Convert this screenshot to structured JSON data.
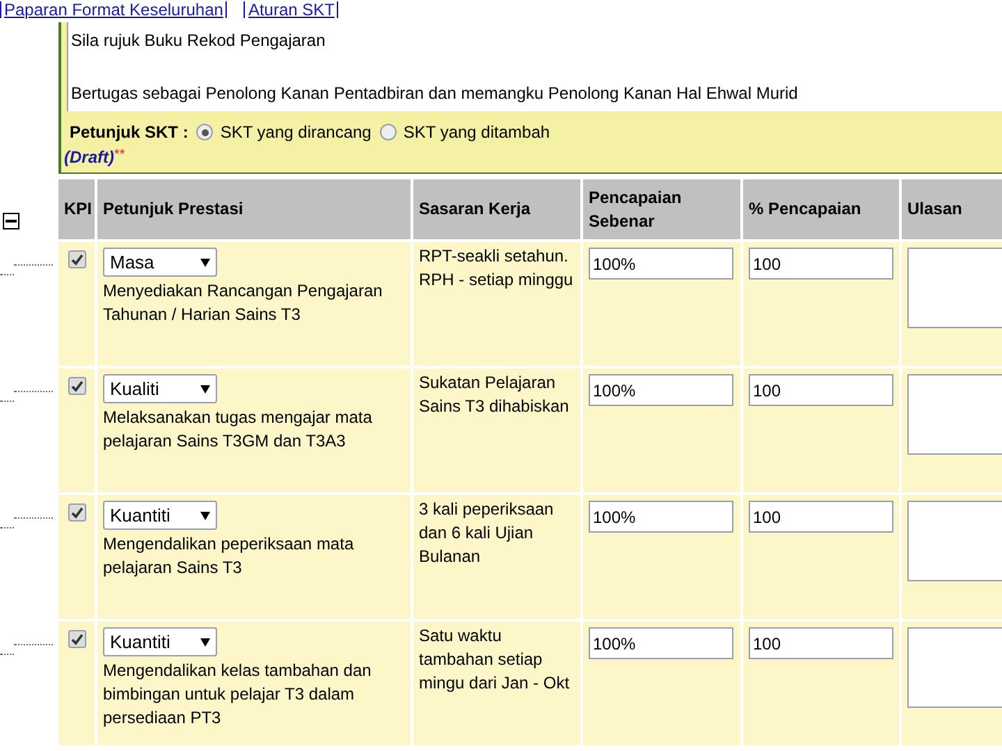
{
  "links": [
    "Paparan Format Keseluruhan",
    "Aturan SKT"
  ],
  "notes": [
    "Sila rujuk Buku Rekod Pengajaran",
    "Bertugas sebagai Penolong Kanan Pentadbiran dan memangku Penolong Kanan Hal Ehwal Murid"
  ],
  "petunjuk": {
    "label": "Petunjuk SKT :",
    "options": [
      {
        "label": "SKT yang dirancang",
        "selected": true
      },
      {
        "label": "SKT yang ditambah",
        "selected": false
      }
    ]
  },
  "draft": {
    "label": "(Draft)",
    "mark": "**"
  },
  "table": {
    "columns": [
      "KPI",
      "Petunjuk Prestasi",
      "Sasaran Kerja",
      "Pencapaian Sebenar",
      "% Pencapaian",
      "Ulasan"
    ],
    "rows": [
      {
        "kpi": true,
        "type": "Masa",
        "description": "Menyediakan Rancangan Pengajaran Tahunan / Harian Sains T3",
        "target": "RPT-seakli setahun. RPH - setiap minggu",
        "actual": "100%",
        "percent": "100"
      },
      {
        "kpi": true,
        "type": "Kualiti",
        "description": "Melaksanakan tugas mengajar mata pelajaran Sains T3GM dan T3A3",
        "target": "Sukatan Pelajaran Sains T3 dihabiskan",
        "actual": "100%",
        "percent": "100"
      },
      {
        "kpi": true,
        "type": "Kuantiti",
        "description": "Mengendalikan peperiksaan mata pelajaran Sains T3",
        "target": "3 kali peperiksaan dan 6 kali Ujian Bulanan",
        "actual": "100%",
        "percent": "100"
      },
      {
        "kpi": true,
        "type": "Kuantiti",
        "description": "Mengendalikan kelas tambahan dan bimbingan untuk pelajar T3 dalam persediaan PT3",
        "target": "Satu waktu tambahan setiap mingu dari Jan - Okt",
        "actual": "100%",
        "percent": "100"
      }
    ]
  }
}
